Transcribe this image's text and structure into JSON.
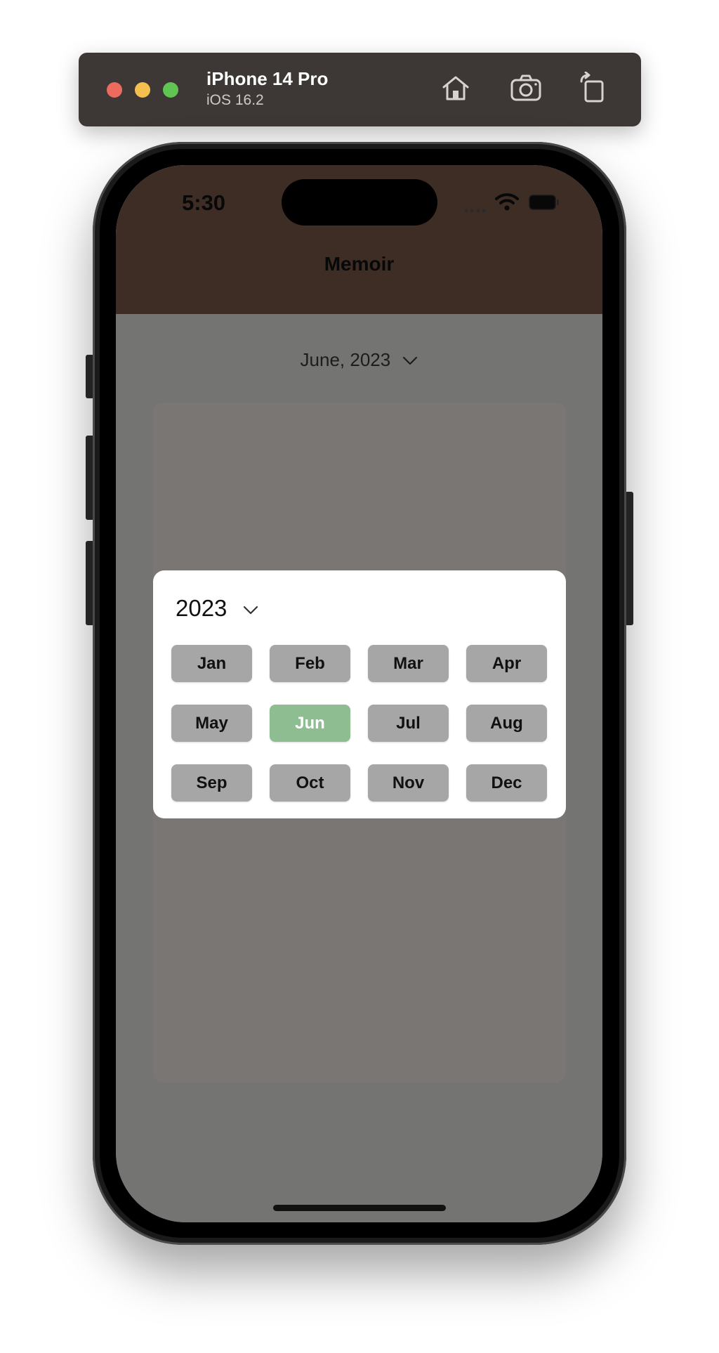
{
  "simulator": {
    "device_name": "iPhone 14 Pro",
    "os_version": "iOS 16.2",
    "toolbar_icons": [
      "home-icon",
      "screenshot-icon",
      "rotate-icon"
    ]
  },
  "status_bar": {
    "time": "5:30",
    "dots": "••••",
    "icons": [
      "wifi-icon",
      "battery-icon"
    ]
  },
  "app": {
    "title": "Memoir",
    "month_selector_label": "June, 2023",
    "colors": {
      "header": "#7a5a4b",
      "selected_month": "#8dbd90",
      "month_button": "#a6a6a6"
    }
  },
  "month_picker": {
    "year": "2023",
    "selected": "Jun",
    "months": [
      "Jan",
      "Feb",
      "Mar",
      "Apr",
      "May",
      "Jun",
      "Jul",
      "Aug",
      "Sep",
      "Oct",
      "Nov",
      "Dec"
    ]
  }
}
